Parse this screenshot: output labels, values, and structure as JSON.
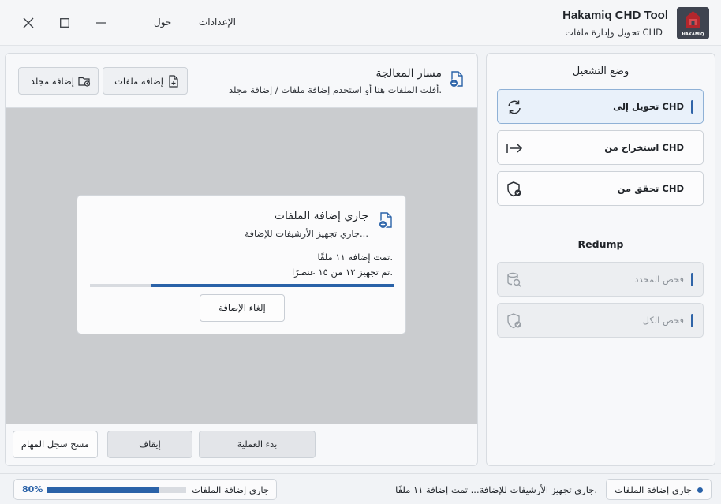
{
  "window": {
    "title": "Hakamiq CHD Tool",
    "subtitle": "تحويل وإدارة ملفات CHD",
    "logo_text": "HAKAMIQ"
  },
  "menu": {
    "settings": "الإعدادات",
    "about": "حول"
  },
  "operation_mode": {
    "heading": "وضع التشغيل",
    "convert": "تحويل إلى CHD",
    "extract": "استخراج من CHD",
    "verify": "تحقق من CHD"
  },
  "redump": {
    "heading": "Redump",
    "scan_selected": "فحص المحدد",
    "scan_all": "فحص الكل"
  },
  "pipeline": {
    "title": "مسار المعالجة",
    "hint": "أفلت الملفات هنا أو استخدم إضافة ملفات / إضافة مجلد.",
    "add_files": "إضافة ملفات",
    "add_folder": "إضافة مجلد"
  },
  "dialog": {
    "title": "جاري إضافة الملفات",
    "subtitle": "جاري تجهيز الأرشيفات للإضافة...",
    "line1": "تمت إضافة ١١ ملفًا.",
    "line2": "تم تجهيز ١٢ من ١٥ عنصرًا.",
    "progress": 0.8,
    "cancel": "إلغاء الإضافة"
  },
  "actions": {
    "start": "بدء العملية",
    "stop": "إيقاف",
    "clear_log": "مسح سجل المهام"
  },
  "status": {
    "state": "جاري إضافة الملفات",
    "message": "جاري تجهيز الأرشيفات للإضافة... تمت إضافة ١١ ملفًا.",
    "progress_label": "جاري إضافة الملفات",
    "progress_percent": "80%",
    "progress_value": 0.8
  },
  "colors": {
    "accent": "#2a62a8"
  }
}
